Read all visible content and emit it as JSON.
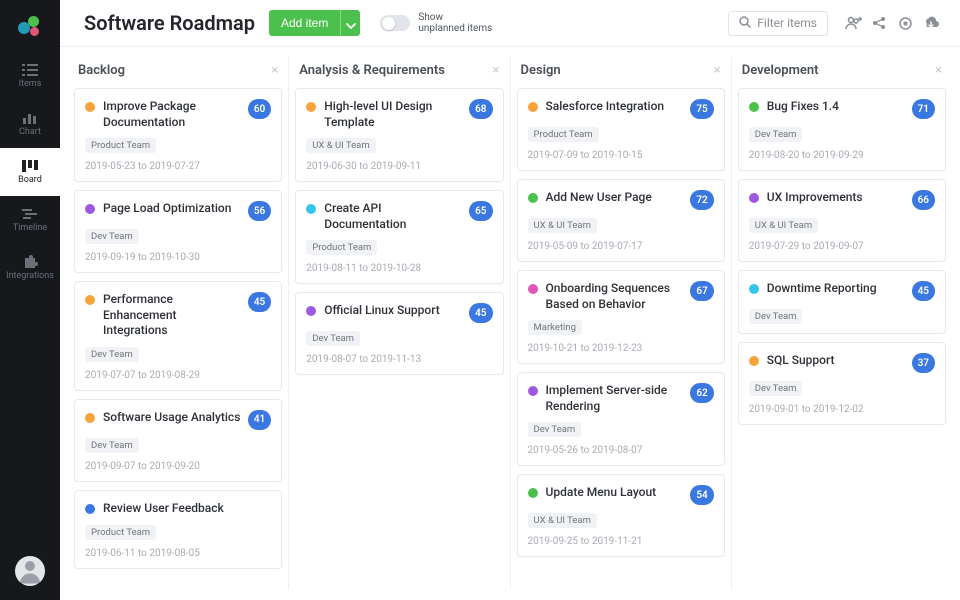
{
  "nav": {
    "items": [
      {
        "label": "Items"
      },
      {
        "label": "Chart"
      },
      {
        "label": "Board"
      },
      {
        "label": "Timeline"
      },
      {
        "label": "Integrations"
      }
    ],
    "activeIndex": 2
  },
  "header": {
    "title": "Software Roadmap",
    "add_label": "Add item",
    "toggle_line1": "Show",
    "toggle_line2": "unplanned items",
    "filter_placeholder": "Filter items"
  },
  "colors": {
    "purple": "#9b59e0",
    "orange": "#f5a33a",
    "blue": "#3a77e0",
    "cyan": "#35c5ea",
    "green": "#4cc04c",
    "pink": "#e254b8"
  },
  "columns": [
    {
      "title": "Backlog",
      "cards": [
        {
          "color": "orange",
          "title": "Improve Package Documentation",
          "badge": "60",
          "team": "Product Team",
          "dates": "2019-05-23 to 2019-07-27"
        },
        {
          "color": "purple",
          "title": "Page Load Optimization",
          "badge": "56",
          "team": "Dev Team",
          "dates": "2019-09-19 to 2019-10-30"
        },
        {
          "color": "orange",
          "title": "Performance Enhancement Integrations",
          "badge": "45",
          "team": "Dev Team",
          "dates": "2019-07-07 to 2019-08-29"
        },
        {
          "color": "orange",
          "title": "Software Usage Analytics",
          "badge": "41",
          "team": "Dev Team",
          "dates": "2019-09-07 to 2019-09-20"
        },
        {
          "color": "blue",
          "title": "Review User Feedback",
          "badge": "",
          "team": "Product Team",
          "dates": "2019-06-11 to 2019-08-05"
        }
      ]
    },
    {
      "title": "Analysis & Requirements",
      "cards": [
        {
          "color": "orange",
          "title": "High-level UI Design Template",
          "badge": "68",
          "team": "UX & UI Team",
          "dates": "2019-06-30 to 2019-09-11"
        },
        {
          "color": "cyan",
          "title": "Create API Documentation",
          "badge": "65",
          "team": "Product Team",
          "dates": "2019-08-11 to 2019-10-28"
        },
        {
          "color": "purple",
          "title": "Official Linux Support",
          "badge": "45",
          "team": "Dev Team",
          "dates": "2019-08-07 to 2019-11-13"
        }
      ]
    },
    {
      "title": "Design",
      "cards": [
        {
          "color": "orange",
          "title": "Salesforce Integration",
          "badge": "75",
          "team": "Product Team",
          "dates": "2019-07-09 to 2019-10-15"
        },
        {
          "color": "green",
          "title": "Add New User Page",
          "badge": "72",
          "team": "UX & UI Team",
          "dates": "2019-05-09 to 2019-07-17"
        },
        {
          "color": "pink",
          "title": "Onboarding Sequences Based on Behavior",
          "badge": "67",
          "team": "Marketing",
          "dates": "2019-10-21 to 2019-12-23"
        },
        {
          "color": "purple",
          "title": "Implement Server-side Rendering",
          "badge": "62",
          "team": "Dev Team",
          "dates": "2019-05-26 to 2019-08-07"
        },
        {
          "color": "green",
          "title": "Update Menu Layout",
          "badge": "54",
          "team": "UX & UI Team",
          "dates": "2019-09-25 to 2019-11-21"
        }
      ]
    },
    {
      "title": "Development",
      "cards": [
        {
          "color": "green",
          "title": "Bug Fixes 1.4",
          "badge": "71",
          "team": "Dev Team",
          "dates": "2019-08-20 to 2019-09-29"
        },
        {
          "color": "purple",
          "title": "UX Improvements",
          "badge": "66",
          "team": "UX & UI Team",
          "dates": "2019-07-29 to 2019-09-07"
        },
        {
          "color": "cyan",
          "title": "Downtime Reporting",
          "badge": "45",
          "team": "Dev Team",
          "dates": ""
        },
        {
          "color": "orange",
          "title": "SQL Support",
          "badge": "37",
          "team": "Dev Team",
          "dates": "2019-09-01 to 2019-12-02"
        }
      ]
    }
  ]
}
